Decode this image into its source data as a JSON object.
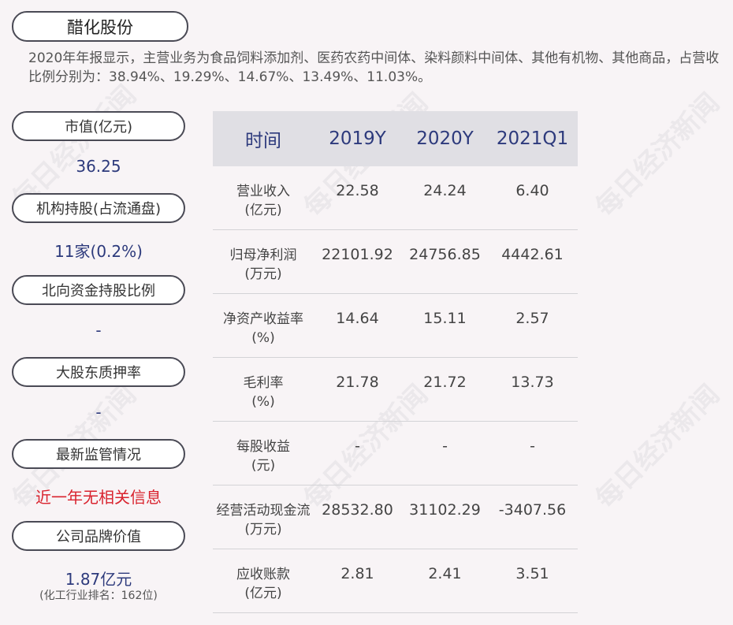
{
  "title": "醋化股份",
  "summary": "2020年年报显示，主营业务为食品饲料添加剂、医药农药中间体、染料颜料中间体、其他有机物、其他商品，占营收比例分别为：38.94%、19.29%、14.67%、13.49%、11.03%。",
  "sidebar": {
    "market_cap": {
      "label": "市值(亿元)",
      "value": "36.25"
    },
    "institution": {
      "label": "机构持股(占流通盘)",
      "value": "11家(0.2%)"
    },
    "northbound": {
      "label": "北向资金持股比例",
      "value": "-"
    },
    "pledge": {
      "label": "大股东质押率",
      "value": "-"
    },
    "regulation": {
      "label": "最新监管情况",
      "value": "近一年无相关信息"
    },
    "brand": {
      "label": "公司品牌价值",
      "value": "1.87亿元",
      "sub": "(化工行业排名：162位)"
    }
  },
  "table": {
    "headers": [
      "时间",
      "2019Y",
      "2020Y",
      "2021Q1"
    ],
    "rows": [
      {
        "name": "营业收入",
        "unit": "(亿元)",
        "values": [
          "22.58",
          "24.24",
          "6.40"
        ]
      },
      {
        "name": "归母净利润",
        "unit": "(万元)",
        "values": [
          "22101.92",
          "24756.85",
          "4442.61"
        ]
      },
      {
        "name": "净资产收益率",
        "unit": "(%)",
        "values": [
          "14.64",
          "15.11",
          "2.57"
        ]
      },
      {
        "name": "毛利率",
        "unit": "(%)",
        "values": [
          "21.78",
          "21.72",
          "13.73"
        ]
      },
      {
        "name": "每股收益",
        "unit": "(元)",
        "values": [
          "-",
          "-",
          "-"
        ]
      },
      {
        "name": "经营活动现金流",
        "unit": "(万元)",
        "values": [
          "28532.80",
          "31102.29",
          "-3407.56"
        ]
      },
      {
        "name": "应收账款",
        "unit": "(亿元)",
        "values": [
          "2.81",
          "2.41",
          "3.51"
        ]
      }
    ]
  },
  "watermark": "每日经济新闻"
}
